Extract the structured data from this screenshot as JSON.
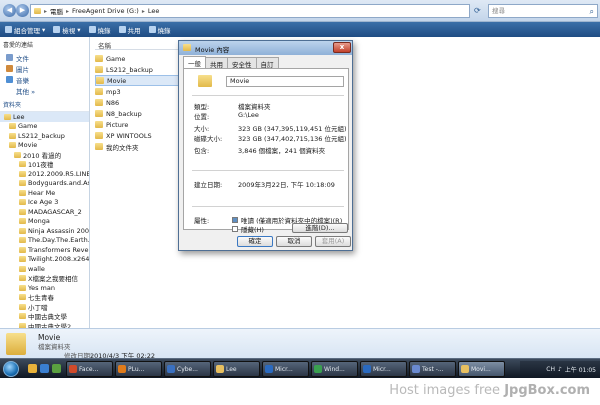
{
  "addressbar": {
    "crumbs": [
      "電腦",
      "FreeAgent Drive (G:)",
      "Lee"
    ],
    "search_placeholder": "搜尋"
  },
  "toolbar": {
    "items": [
      "組合管理",
      "檢視",
      "燒錄",
      "共用",
      "燒錄"
    ]
  },
  "sidebar": {
    "favorites_header": "喜愛的連結",
    "favorites": [
      {
        "label": "文件",
        "color": "#7a9ccc"
      },
      {
        "label": "圖片",
        "color": "#d08a3c"
      },
      {
        "label": "音樂",
        "color": "#4f8fd4"
      },
      {
        "label": "其他 »",
        "color": "#ffffff"
      }
    ],
    "tree_header": "資料夾",
    "tree": [
      {
        "label": "Lee",
        "indent": 0,
        "selected": true
      },
      {
        "label": "Game",
        "indent": 1
      },
      {
        "label": "LS212_backup",
        "indent": 1
      },
      {
        "label": "Movie",
        "indent": 1
      },
      {
        "label": "2010 看過的",
        "indent": 2
      },
      {
        "label": "101夜禮",
        "indent": 3
      },
      {
        "label": "2012.2009.R5.LINE",
        "indent": 3
      },
      {
        "label": "Bodyguards.and.As",
        "indent": 3
      },
      {
        "label": "Hear Me",
        "indent": 3
      },
      {
        "label": "Ice Age 3",
        "indent": 3
      },
      {
        "label": "MADAGASCAR_2",
        "indent": 3
      },
      {
        "label": "Monga",
        "indent": 3
      },
      {
        "label": "Ninja Assassin 2009",
        "indent": 3
      },
      {
        "label": "The.Day.The.Earth.S",
        "indent": 3
      },
      {
        "label": "Transformers Rever",
        "indent": 3
      },
      {
        "label": "Twilight.2008.x264.",
        "indent": 3
      },
      {
        "label": "walle",
        "indent": 3
      },
      {
        "label": "X檔案之我要相信",
        "indent": 3
      },
      {
        "label": "Yes man",
        "indent": 3
      },
      {
        "label": "七生青春",
        "indent": 3
      },
      {
        "label": "小丁噹",
        "indent": 3
      },
      {
        "label": "中國古典文學",
        "indent": 3
      },
      {
        "label": "中國古典文學2",
        "indent": 3
      }
    ]
  },
  "filelist": {
    "column_name": "名稱",
    "items": [
      {
        "label": "Game"
      },
      {
        "label": "LS212_backup"
      },
      {
        "label": "Movie",
        "selected": true
      },
      {
        "label": "mp3"
      },
      {
        "label": "N86"
      },
      {
        "label": "N8_backup"
      },
      {
        "label": "Picture"
      },
      {
        "label": "XP WINTOOLS"
      },
      {
        "label": "我的文件夾"
      }
    ]
  },
  "details": {
    "name": "Movie",
    "type": "檔案資料夾",
    "modified_label": "修改日期:",
    "modified_value": "2010/4/3 下午 02:22"
  },
  "taskbar": {
    "quicklaunch": [
      "#e8b23a",
      "#3a7fd0",
      "#5aa040"
    ],
    "tasks": [
      {
        "label": "Face...",
        "color": "#d04a2a"
      },
      {
        "label": "PLu...",
        "color": "#e07b1a"
      },
      {
        "label": "Cybe...",
        "color": "#3a70c0"
      },
      {
        "label": "Lee",
        "color": "#e8c060"
      },
      {
        "label": "Micr...",
        "color": "#2a6ac0"
      },
      {
        "label": "Wind...",
        "color": "#3aa050"
      },
      {
        "label": "Micr...",
        "color": "#2a6ac0"
      },
      {
        "label": "Test -...",
        "color": "#6a8ad0"
      },
      {
        "label": "Movi...",
        "color": "#e8c060",
        "active": true
      }
    ],
    "tray_time": "上午 01:05",
    "tray_lang": "CH"
  },
  "watermark": {
    "prefix": "Host images free ",
    "brand": "JpgBox.com"
  },
  "dialog": {
    "title": "Movie 內容",
    "close_label": "x",
    "tabs": [
      "一般",
      "共用",
      "安全性",
      "自訂"
    ],
    "name_value": "Movie",
    "rows": [
      {
        "label": "類型:",
        "value": "檔案資料夾"
      },
      {
        "label": "位置:",
        "value": "G:\\Lee"
      },
      {
        "label": "大小:",
        "value": "323 GB (347,395,119,451 位元組)"
      },
      {
        "label": "磁碟大小:",
        "value": "323 GB (347,402,715,136 位元組)"
      },
      {
        "label": "包含:",
        "value": "3,846 個檔案，241 個資料夾"
      },
      {
        "label": "建立日期:",
        "value": "2009年3月22日, 下午 10:18:09"
      }
    ],
    "attr_label": "屬性:",
    "readonly_label": "唯讀 (僅適用於資料夾中的檔案)(R)",
    "hidden_label": "隱藏(H)",
    "advanced_label": "進階(D)...",
    "ok_label": "確定",
    "cancel_label": "取消",
    "apply_label": "套用(A)"
  }
}
